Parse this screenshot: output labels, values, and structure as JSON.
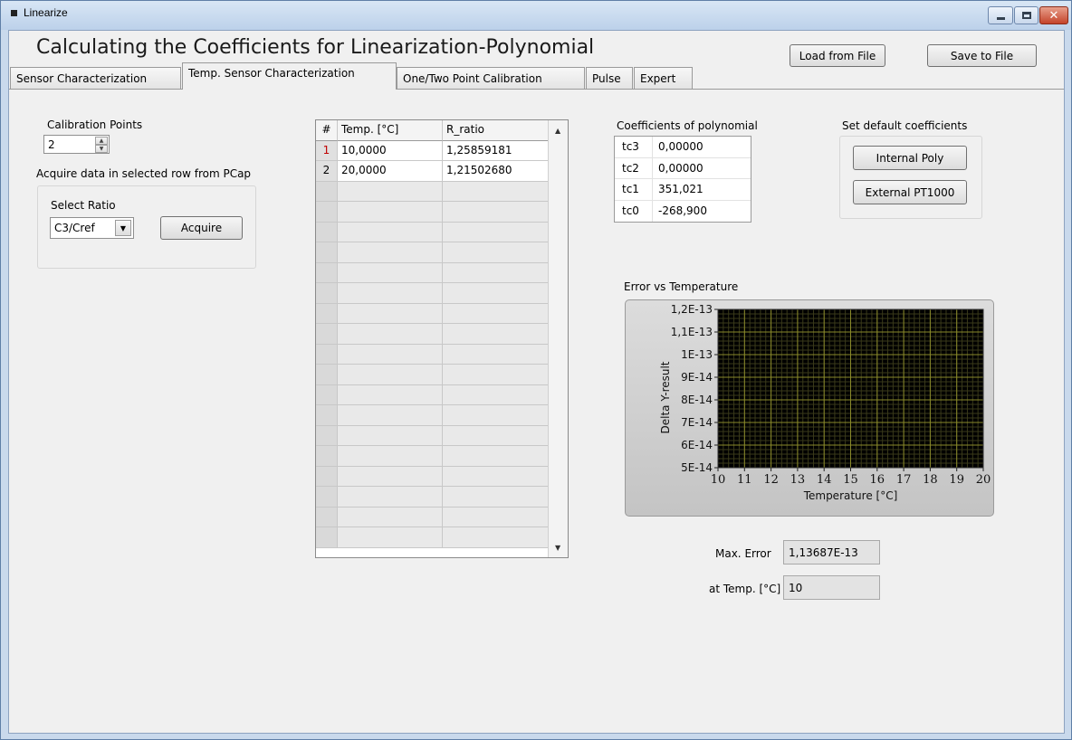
{
  "window": {
    "title": "Linearize"
  },
  "app_title": "Calculating the Coefficients for Linearization-Polynomial",
  "buttons": {
    "load": "Load from File",
    "save": "Save to File",
    "acquire": "Acquire",
    "internal_poly": "Internal Poly",
    "external_pt1000": "External PT1000"
  },
  "tabs": [
    {
      "label": "Sensor Characterization",
      "active": false
    },
    {
      "label": "Temp. Sensor Characterization",
      "active": true
    },
    {
      "label": "One/Two Point Calibration",
      "active": false
    },
    {
      "label": "Pulse",
      "active": false
    },
    {
      "label": "Expert",
      "active": false
    }
  ],
  "calibration": {
    "label": "Calibration Points",
    "value": "2"
  },
  "acquire": {
    "label": "Acquire data in selected row from PCap",
    "select_label": "Select Ratio",
    "ratio_value": "C3/Cref"
  },
  "table": {
    "headers": [
      "#",
      "Temp. [°C]",
      "R_ratio"
    ],
    "rows": [
      [
        "1",
        "10,0000",
        "1,25859181"
      ],
      [
        "2",
        "20,0000",
        "1,21502680"
      ]
    ],
    "empty_rows": 18
  },
  "coefficients": {
    "label": "Coefficients of polynomial",
    "rows": [
      {
        "key": "tc3",
        "value": "0,00000"
      },
      {
        "key": "tc2",
        "value": "0,00000"
      },
      {
        "key": "tc1",
        "value": "351,021"
      },
      {
        "key": "tc0",
        "value": "-268,900"
      }
    ]
  },
  "defaults": {
    "label": "Set default coefficients"
  },
  "results": {
    "max_error_label": "Max. Error",
    "max_error_value": "1,13687E-13",
    "at_temp_label": "at Temp. [°C]",
    "at_temp_value": "10"
  },
  "colors": {
    "plot_bg": "#000000",
    "grid_major": "#8a8a2a",
    "grid_minor": "#3a3a1a"
  },
  "chart_data": {
    "type": "line",
    "title": "Error vs Temperature",
    "xlabel": "Temperature [°C]",
    "ylabel": "Delta Y-result",
    "xlim": [
      10,
      20
    ],
    "ylim": [
      5e-14,
      1.2e-13
    ],
    "x_ticks": [
      "10",
      "11",
      "12",
      "13",
      "14",
      "15",
      "16",
      "17",
      "18",
      "19",
      "20"
    ],
    "y_ticks": [
      "1,2E-13",
      "1,1E-13",
      "1E-13",
      "9E-14",
      "8E-14",
      "7E-14",
      "6E-14",
      "5E-14"
    ],
    "y_tick_values": [
      1.2e-13,
      1.1e-13,
      1e-13,
      9e-14,
      8e-14,
      7e-14,
      6e-14,
      5e-14
    ],
    "grid": true,
    "series": []
  }
}
